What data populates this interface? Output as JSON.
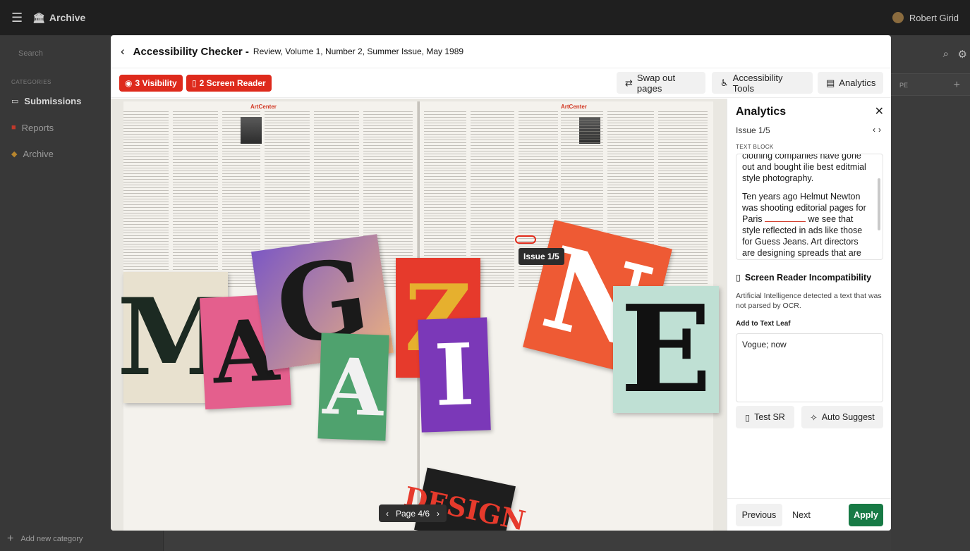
{
  "app": {
    "brand": "Archive",
    "user_name": "Robert Girid"
  },
  "sidebar": {
    "search_placeholder": "Search",
    "categories_label": "CATEGORIES",
    "items": [
      {
        "label": "Submissions",
        "active": true
      },
      {
        "label": "Reports",
        "active": false
      },
      {
        "label": "Archive",
        "active": false
      }
    ],
    "add_category": "Add new category"
  },
  "background_right": {
    "column_header": "PE"
  },
  "modal": {
    "title": "Accessibility Checker -",
    "subtitle": "Review, Volume 1, Number 2, Summer Issue, May 1989",
    "toolbar": {
      "visibility_label": "3 Visibility",
      "screen_reader_label": "2 Screen Reader",
      "swap_label": "Swap out pages",
      "tools_label": "Accessibility Tools",
      "analytics_label": "Analytics",
      "issue_color": "#de2a1c"
    },
    "viewer": {
      "issue_tooltip": "Issue 1/5",
      "page_indicator": "Page 4/6",
      "magazine_letters": [
        "M",
        "A",
        "G",
        "A",
        "Z",
        "I",
        "N",
        "E"
      ],
      "magazine_headline": "DESIGN"
    },
    "panel": {
      "title": "Analytics",
      "issue_counter": "Issue 1/5",
      "text_block_label": "TEXT BLOCK",
      "text_block_p1": "clothing companies have gone out and bought ilie best editmial style photography.",
      "text_block_p2_a": "Ten years ago Helmut Newton was shooting editorial pages for Paris",
      "text_block_p2_b": "we see that style reflected in ads like those for Guess Jeans. Art directors are designing spreads that are cleaner and flatter so that the",
      "sr_title": "Screen Reader Incompatibility",
      "sr_desc": "Artificial Intelligence detected a text that was not parsed by OCR.",
      "add_label": "Add to Text Leaf",
      "leaf_value": "Vogue; now",
      "test_label": "Test SR",
      "auto_label": "Auto Suggest",
      "prev_label": "Previous",
      "next_label": "Next",
      "apply_label": "Apply",
      "apply_color": "#177a45"
    }
  }
}
